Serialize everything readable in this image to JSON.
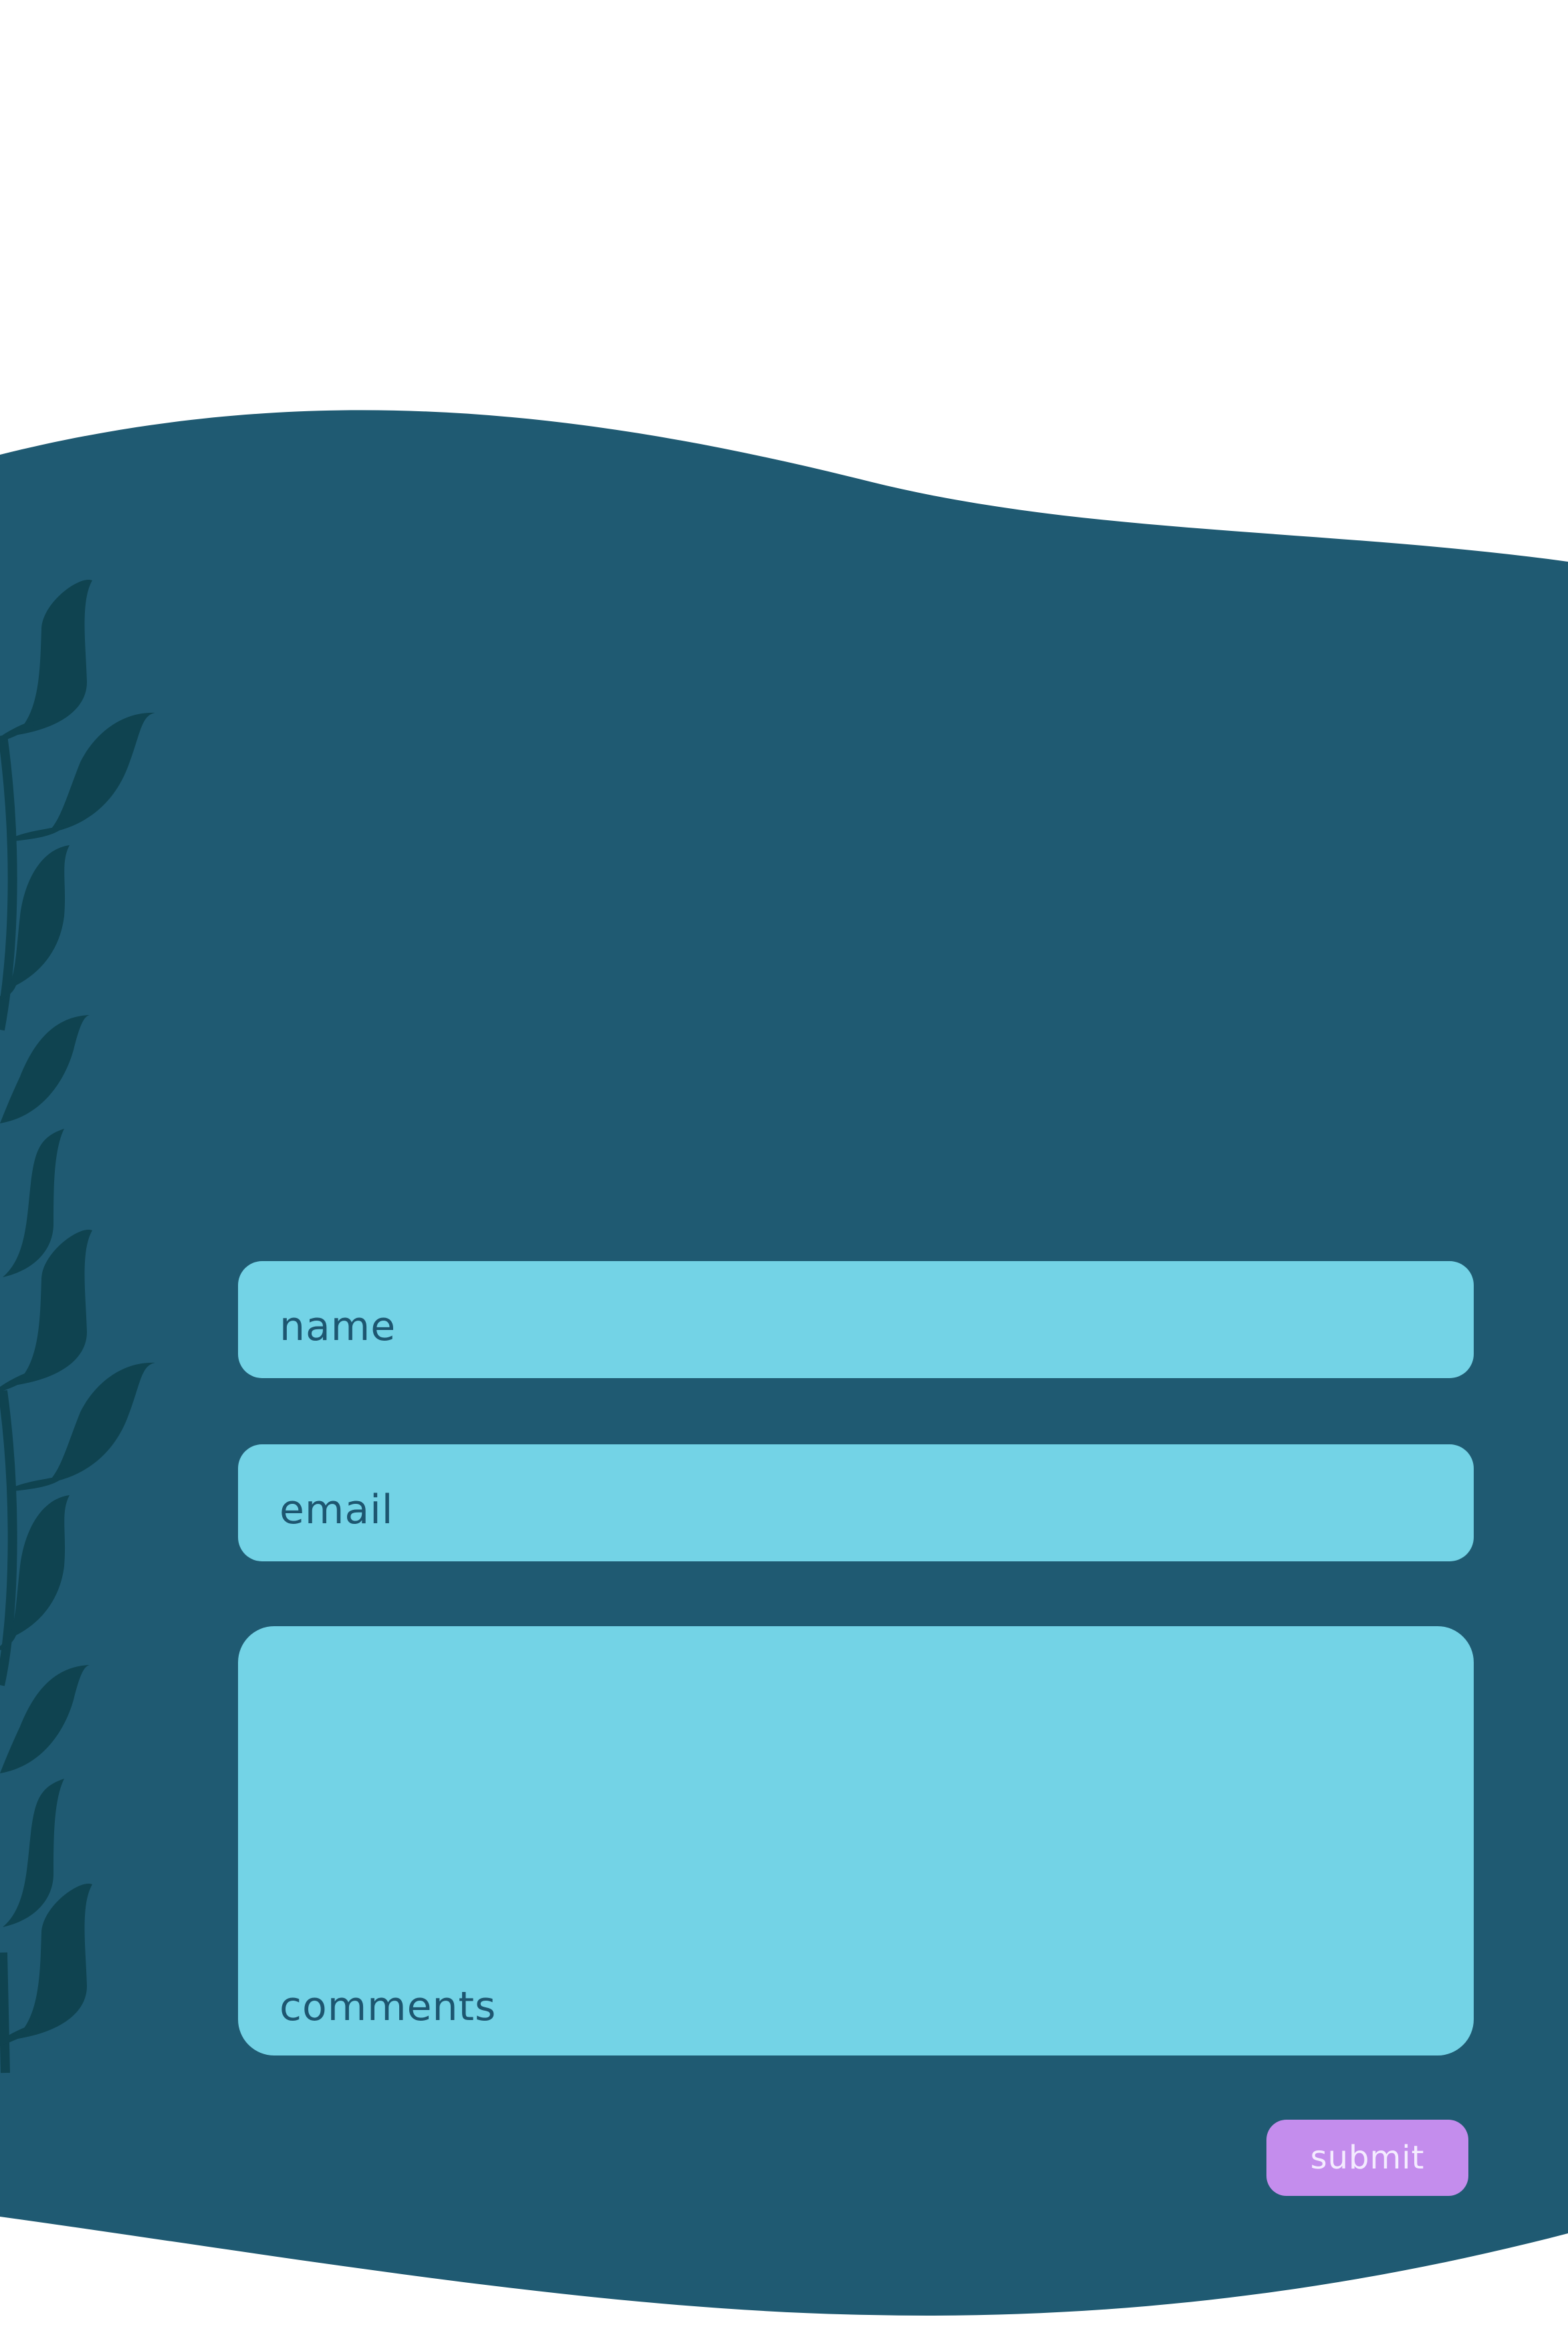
{
  "colors": {
    "background": "#ffffff",
    "panel": "#1f5a72",
    "leaves": "#0f4350",
    "field_fill": "#73d3e6",
    "field_text": "#1d5670",
    "submit_fill": "#c48ded",
    "submit_text": "#f4ecff"
  },
  "form": {
    "name_placeholder": "name",
    "email_placeholder": "email",
    "comments_placeholder": "comments",
    "submit_label": "submit"
  },
  "decoration": {
    "left_edge": "leafy-vine-icon"
  }
}
